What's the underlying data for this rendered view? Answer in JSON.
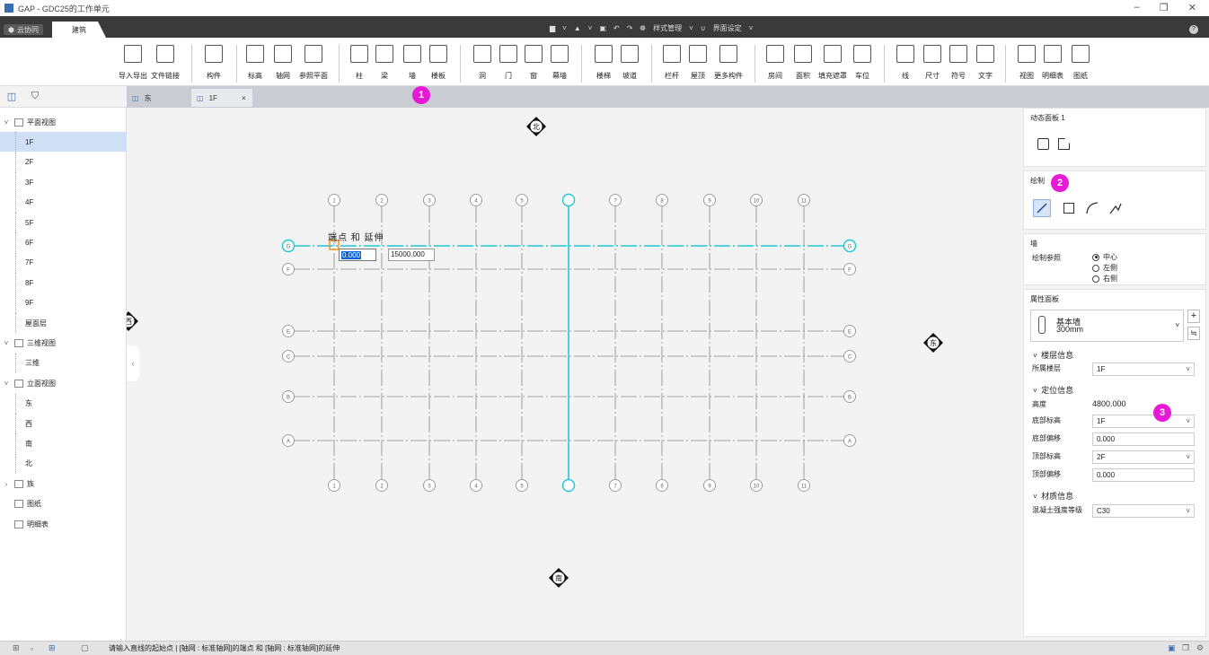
{
  "window": {
    "title": "GAP - GDC25的工作单元",
    "min_icon": "minimize-icon",
    "max_icon": "restore-icon",
    "close_icon": "close-icon"
  },
  "menu": {
    "cloud_tab": "云协同",
    "arch_tab": "建筑",
    "quick_tools": [
      "save-icon",
      "export-icon",
      "screenshot-icon",
      "undo-icon",
      "redo-icon"
    ],
    "style_manage": "样式管理",
    "ui_setting": "界面设定"
  },
  "ribbon": {
    "groups": [
      [
        "导入导出",
        "文件链接"
      ],
      [
        "构件"
      ],
      [
        "标高",
        "轴网",
        "参照平面"
      ],
      [
        "柱",
        "梁",
        "墙",
        "楼板"
      ],
      [
        "洞",
        "门",
        "窗",
        "幕墙"
      ],
      [
        "楼梯",
        "坡道"
      ],
      [
        "栏杆",
        "屋顶",
        "更多构件"
      ],
      [
        "房间",
        "面积",
        "填充遮罩",
        "车位"
      ],
      [
        "线",
        "尺寸",
        "符号",
        "文字"
      ],
      [
        "视图",
        "明细表",
        "图纸"
      ]
    ]
  },
  "doc_tabs": {
    "tab1": "东",
    "tab2": "1F",
    "close": "×"
  },
  "tree": [
    {
      "label": "平面视图",
      "level": 0,
      "exp": "˅"
    },
    {
      "label": "1F",
      "level": 1,
      "sel": true
    },
    {
      "label": "2F",
      "level": 1
    },
    {
      "label": "3F",
      "level": 1
    },
    {
      "label": "4F",
      "level": 1
    },
    {
      "label": "5F",
      "level": 1
    },
    {
      "label": "6F",
      "level": 1
    },
    {
      "label": "7F",
      "level": 1
    },
    {
      "label": "8F",
      "level": 1
    },
    {
      "label": "9F",
      "level": 1
    },
    {
      "label": "屋面层",
      "level": 1
    },
    {
      "label": "三维视图",
      "level": 0,
      "exp": "˅"
    },
    {
      "label": "三维",
      "level": 1
    },
    {
      "label": "立面视图",
      "level": 0,
      "exp": "˅"
    },
    {
      "label": "东",
      "level": 1
    },
    {
      "label": "西",
      "level": 1
    },
    {
      "label": "南",
      "level": 1
    },
    {
      "label": "北",
      "level": 1
    },
    {
      "label": "族",
      "level": 0,
      "exp": "›"
    },
    {
      "label": "图纸",
      "level": 0
    },
    {
      "label": "明细表",
      "level": 0
    }
  ],
  "canvas": {
    "compass": {
      "north": "北",
      "south": "南",
      "east": "东",
      "west": "西"
    },
    "snap_tip": "端点 和 延伸",
    "input_x": "0.000",
    "input_len": "15000.000",
    "col_labels": [
      "1",
      "2",
      "3",
      "4",
      "5",
      "6",
      "7",
      "8",
      "9",
      "10",
      "11"
    ],
    "row_labels": [
      "G",
      "F",
      "E",
      "C",
      "B",
      "A"
    ],
    "accent": "#1fc6d6"
  },
  "panel": {
    "dynamic_title": "动态面板 1",
    "draw_title": "绘制",
    "wall_title": "墙",
    "draw_ref_label": "绘制参照",
    "radio": [
      "中心",
      "左侧",
      "右侧"
    ],
    "prop_title": "属性面板",
    "wall_type": "基本墙",
    "wall_thick": "300mm",
    "sec_floor": "楼层信息",
    "floor_label": "所属楼层",
    "floor_value": "1F",
    "sec_loc": "定位信息",
    "height_label": "高度",
    "height_value": "4800.000",
    "base_level_label": "底部标高",
    "base_level_value": "1F",
    "base_offset_label": "底部偏移",
    "base_offset_value": "0.000",
    "top_level_label": "顶部标高",
    "top_level_value": "2F",
    "top_offset_label": "顶部偏移",
    "top_offset_value": "0.000",
    "sec_mat": "材质信息",
    "concrete_label": "混凝土强度等级",
    "concrete_value": "C30"
  },
  "status": {
    "message": "请输入直线的起始点 | [轴网 : 标准轴网]的端点 和 [轴网 : 标准轴网]的延伸"
  },
  "badges": [
    "1",
    "2",
    "3"
  ]
}
